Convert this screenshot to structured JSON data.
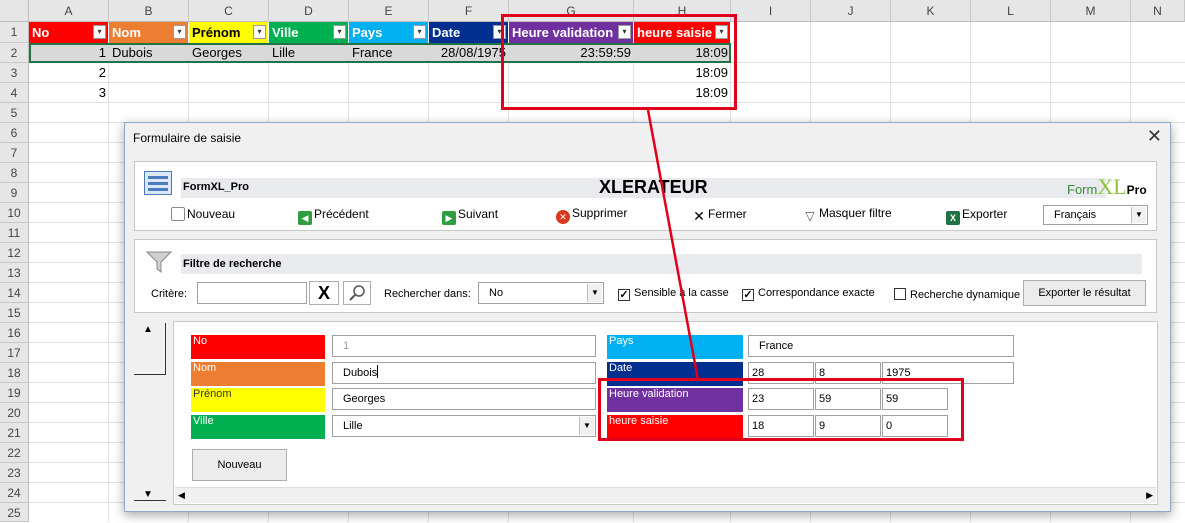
{
  "sheet": {
    "columns": [
      "A",
      "B",
      "C",
      "D",
      "E",
      "F",
      "G",
      "H",
      "I",
      "J",
      "K",
      "L",
      "M",
      "N"
    ],
    "rows": [
      "1",
      "2",
      "3",
      "4",
      "5",
      "6",
      "7",
      "8",
      "9",
      "10",
      "11",
      "12",
      "13",
      "14",
      "15",
      "16",
      "17",
      "18",
      "19",
      "20",
      "21",
      "22",
      "23",
      "24",
      "25"
    ],
    "headers": [
      "No",
      "Nom",
      "Prénom",
      "Ville",
      "Pays",
      "Date",
      "Heure validation",
      "heure saisie"
    ],
    "header_colors": [
      "#ff0000",
      "#ed7d31",
      "#ffff00",
      "#00b050",
      "#00b0f0",
      "#002f8f",
      "#7030a0",
      "#ff0000"
    ],
    "filter_glyph": "▾",
    "data": [
      [
        "1",
        "Dubois",
        "Georges",
        "Lille",
        "France",
        "28/08/1975",
        "23:59:59",
        "18:09"
      ],
      [
        "2",
        "",
        "",
        "",
        "",
        "",
        "",
        "18:09"
      ],
      [
        "3",
        "",
        "",
        "",
        "",
        "",
        "",
        "18:09"
      ]
    ]
  },
  "dialog": {
    "title": "Formulaire de saisie",
    "close_glyph": "✕",
    "app_name": "FormXL_Pro",
    "banner": "XLERATEUR",
    "logo": {
      "part1": "Form",
      "part2": "XL",
      "part3": "Pro"
    },
    "toolbar": {
      "new": "Nouveau",
      "prev": "Précédent",
      "next": "Suivant",
      "delete": "Supprimer",
      "close": "Fermer",
      "hide_filter": "Masquer filtre",
      "export": "Exporter",
      "language": "Français"
    },
    "filter": {
      "title": "Filtre de recherche",
      "criteria_label": "Critère:",
      "criteria_value": "",
      "clear_glyph": "X",
      "search_in_label": "Rechercher dans:",
      "search_in_value": "No",
      "case_sensitive": "Sensible à la casse",
      "exact_match": "Correspondance exacte",
      "dynamic": "Recherche dynamique",
      "export_result": "Exporter le résultat"
    },
    "fields": {
      "no_label": "No",
      "no_value": "1",
      "nom_label": "Nom",
      "nom_value": "Dubois",
      "prenom_label": "Prénom",
      "prenom_value": "Georges",
      "ville_label": "Ville",
      "ville_value": "Lille",
      "pays_label": "Pays",
      "pays_value": "France",
      "date_label": "Date",
      "date_day": "28",
      "date_month": "8",
      "date_year": "1975",
      "hv_label": "Heure validation",
      "hv_h": "23",
      "hv_m": "59",
      "hv_s": "59",
      "hs_label": "heure saisie",
      "hs_h": "18",
      "hs_m": "9",
      "hs_s": "0"
    },
    "new_button": "Nouveau",
    "scroll_up": "▲",
    "scroll_down": "▼",
    "scroll_left": "◀",
    "scroll_right": "▶"
  }
}
